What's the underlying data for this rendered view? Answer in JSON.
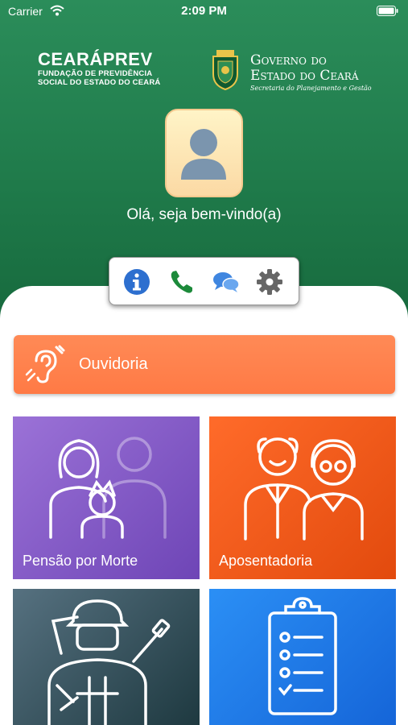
{
  "status_bar": {
    "carrier": "Carrier",
    "time": "2:09 PM"
  },
  "brand_left": {
    "name": "CEARÁPREV",
    "line1": "FUNDAÇÃO DE PREVIDÊNCIA",
    "line2": "SOCIAL DO ESTADO DO CEARÁ"
  },
  "brand_right": {
    "line1": "Governo do",
    "line2": "Estado do Ceará",
    "line3": "Secretaria do Planejamento e Gestão"
  },
  "greeting": "Olá, seja bem-vindo(a)",
  "actions": [
    {
      "icon": "info-icon"
    },
    {
      "icon": "phone-icon"
    },
    {
      "icon": "chat-icon"
    },
    {
      "icon": "gear-icon"
    }
  ],
  "ouvidoria": {
    "label": "Ouvidoria",
    "icon": "ear-icon"
  },
  "tiles": [
    {
      "label": "Pensão por Morte",
      "icon": "family-icon",
      "color": "#8a5fcf"
    },
    {
      "label": "Aposentadoria",
      "icon": "elderly-couple-icon",
      "color": "#f25c1c"
    },
    {
      "label": "",
      "icon": "soldier-icon",
      "color": "#3a5560"
    },
    {
      "label": "",
      "icon": "clipboard-icon",
      "color": "#1f7ae6"
    }
  ],
  "colors": {
    "header_green": "#1f7a4a",
    "ouvidoria_orange": "#ff7a45",
    "icon_blue": "#2d6fcf",
    "icon_green": "#1c8a3a",
    "icon_gray": "#666666"
  }
}
